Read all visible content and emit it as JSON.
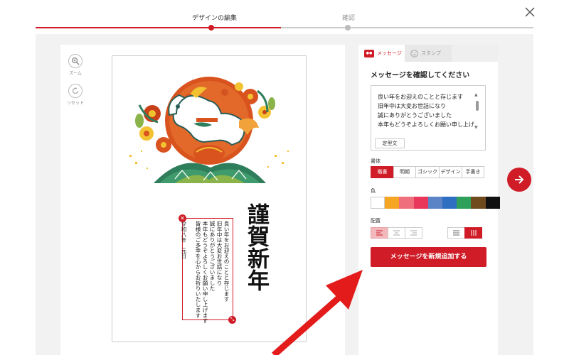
{
  "steps": [
    {
      "label": "デザインの編集",
      "active": true
    },
    {
      "label": "確認",
      "active": false
    }
  ],
  "tools": {
    "zoom_label": "ズーム",
    "reset_label": "リセット"
  },
  "card": {
    "greeting_title": "謹賀新年",
    "message_vertical": "良い年をお迎えのことと存じます\n旧年中は大変お世話になり\n誠にありがとうございました\n本年もどうぞよろしくお願い申し上げます\n皆様のご多幸を心からお祈りいたします\n\n令和八年　元日"
  },
  "panel": {
    "tabs": [
      {
        "label": "メッセージ",
        "icon": "message-icon",
        "active": true
      },
      {
        "label": "スタンプ",
        "icon": "smile-icon",
        "active": false
      }
    ],
    "heading": "メッセージを確認してください",
    "message_text": "良い年をお迎えのことと存じます\n旧年中は大変お世話になり\n誠にありがとうございました\n本年もどうぞよろしくお願い申し上げます\n皆様のご多幸を心からお祈りいたします",
    "template_button": "定型文",
    "font_label": "書体",
    "fonts": [
      {
        "label": "楷書",
        "selected": true
      },
      {
        "label": "明朝",
        "selected": false
      },
      {
        "label": "ゴシック",
        "selected": false
      },
      {
        "label": "デザイン",
        "selected": false
      },
      {
        "label": "手書き",
        "selected": false
      }
    ],
    "color_label": "色",
    "colors": [
      "#ffffff",
      "#f5a623",
      "#f06f7d",
      "#e8375a",
      "#5b84c6",
      "#2e6fc2",
      "#2ea05a",
      "#6f4a1d",
      "#111111"
    ],
    "layout_label": "配置",
    "add_button": "メッセージを新規追加する"
  },
  "theme": {
    "accent": "#cf1c27"
  }
}
